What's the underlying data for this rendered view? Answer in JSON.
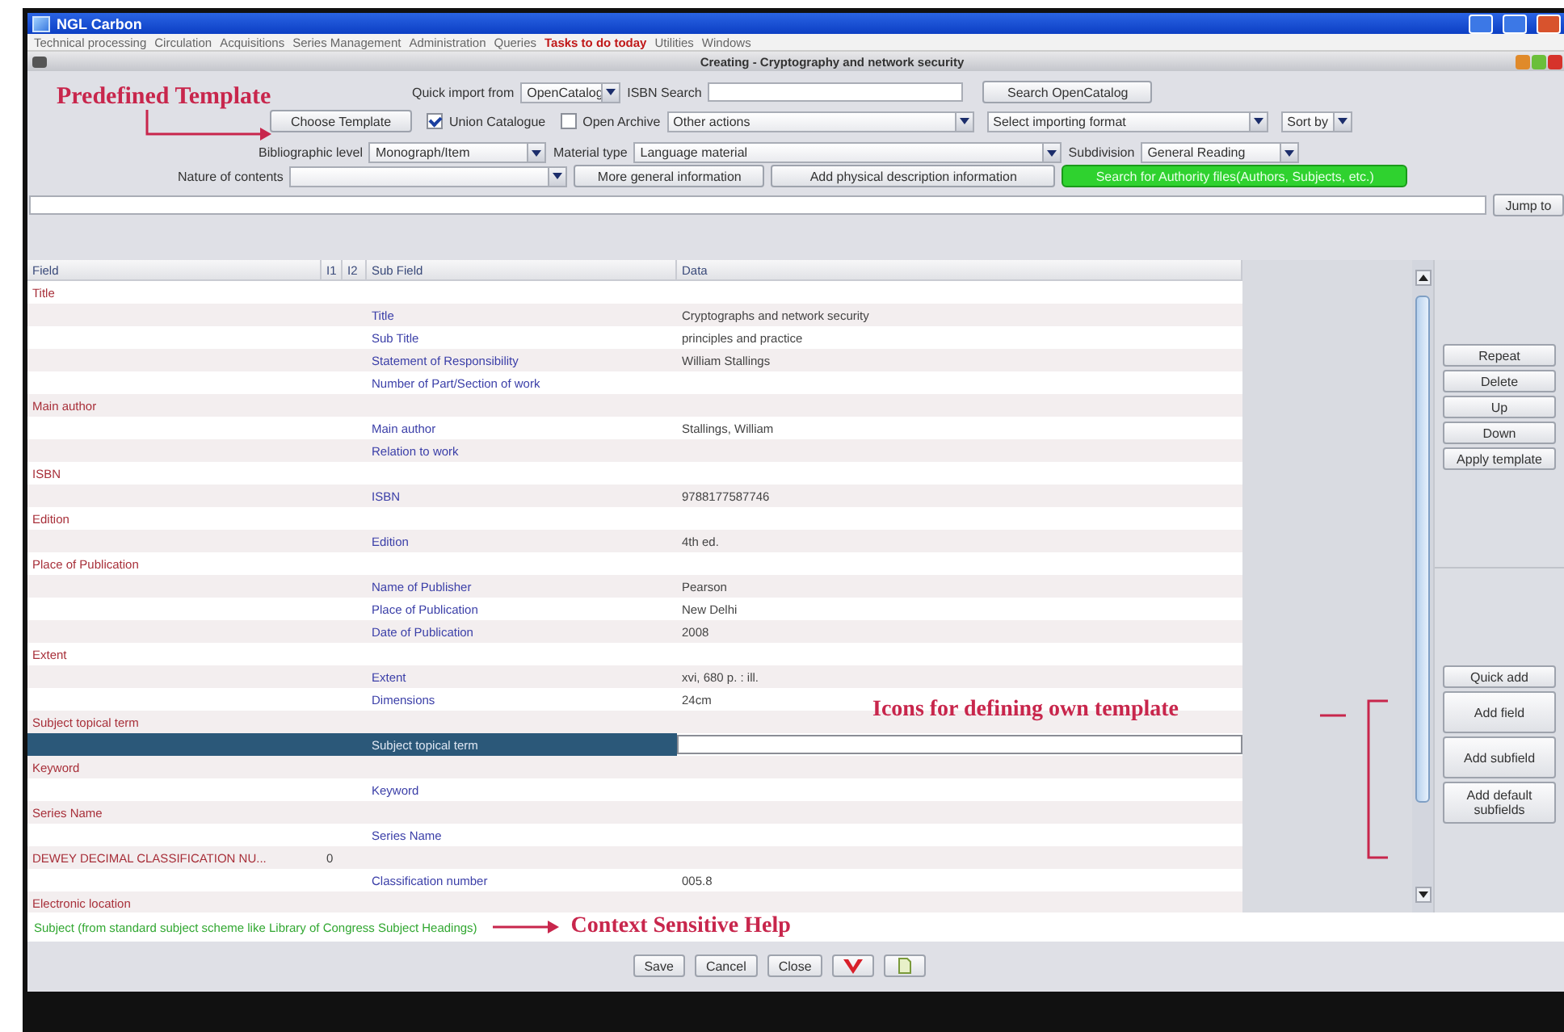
{
  "window": {
    "title": "NGL Carbon"
  },
  "menu": [
    {
      "label": "Technical processing",
      "highlighted": false
    },
    {
      "label": "Circulation",
      "highlighted": false
    },
    {
      "label": "Acquisitions",
      "highlighted": false
    },
    {
      "label": "Series Management",
      "highlighted": false
    },
    {
      "label": "Administration",
      "highlighted": false
    },
    {
      "label": "Queries",
      "highlighted": false
    },
    {
      "label": "Tasks to do today",
      "highlighted": true
    },
    {
      "label": "Utilities",
      "highlighted": false
    },
    {
      "label": "Windows",
      "highlighted": false
    }
  ],
  "frame": {
    "title": "Creating - Cryptography and network security"
  },
  "toolbar": {
    "quick_import_label": "Quick import from",
    "quick_import_value": "OpenCatalog",
    "isbn_label": "ISBN Search",
    "search_button": "Search OpenCatalog",
    "choose_template": "Choose Template",
    "checkboxes": [
      {
        "label": "Union Catalogue",
        "checked": true
      },
      {
        "label": "Open Archive",
        "checked": false
      }
    ],
    "other_actions": "Other actions",
    "import_format": "Select importing format",
    "sort_by": "Sort by",
    "bibliographic_level_label": "Bibliographic level",
    "bibliographic_level": "Monograph/Item",
    "material_type_label": "Material type",
    "material_type": "Language material",
    "subdivision_label": "Subdivision",
    "subdivision": "General Reading",
    "nature_label": "Nature of contents",
    "more_info_button": "More general information",
    "physical_button": "Add physical description information",
    "authority_button": "Search for Authority files(Authors, Subjects, etc.)",
    "jump_button": "Jump to"
  },
  "table": {
    "columns": [
      "Field",
      "I1",
      "I2",
      "Sub Field",
      "Data"
    ],
    "rows": [
      {
        "kind": "field",
        "text": "Title",
        "selected": false
      },
      {
        "kind": "subfield",
        "text": "Title",
        "data": "Cryptographs and network security",
        "selected": false
      },
      {
        "kind": "subfield",
        "text": "Sub Title",
        "data": "principles and practice",
        "selected": false
      },
      {
        "kind": "subfield",
        "text": "Statement of Responsibility",
        "data": "William Stallings",
        "selected": false
      },
      {
        "kind": "subfield",
        "text": "Number of Part/Section of work",
        "selected": false
      },
      {
        "kind": "field",
        "text": "Main author",
        "selected": false
      },
      {
        "kind": "subfield",
        "text": "Main author",
        "data": "Stallings, William",
        "selected": false
      },
      {
        "kind": "subfield",
        "text": "Relation to work",
        "selected": false
      },
      {
        "kind": "field",
        "text": "ISBN",
        "selected": false
      },
      {
        "kind": "subfield",
        "text": "ISBN",
        "data": "9788177587746",
        "selected": false
      },
      {
        "kind": "field",
        "text": "Edition",
        "selected": false
      },
      {
        "kind": "subfield",
        "text": "Edition",
        "data": "4th ed.",
        "selected": false
      },
      {
        "kind": "field",
        "text": "Place of Publication",
        "selected": false
      },
      {
        "kind": "subfield",
        "text": "Name of Publisher",
        "data": "Pearson",
        "selected": false
      },
      {
        "kind": "subfield",
        "text": "Place of Publication",
        "data": "New Delhi",
        "selected": false
      },
      {
        "kind": "subfield",
        "text": "Date of Publication",
        "data": "2008",
        "selected": false
      },
      {
        "kind": "field",
        "text": "Extent",
        "selected": false
      },
      {
        "kind": "subfield",
        "text": "Extent",
        "data": "xvi, 680 p. : ill.",
        "selected": false
      },
      {
        "kind": "subfield",
        "text": "Dimensions",
        "data": "24cm",
        "selected": false
      },
      {
        "kind": "field",
        "text": "Subject topical term",
        "selected": false
      },
      {
        "kind": "subfield",
        "text": "Subject topical term",
        "selected": true
      },
      {
        "kind": "field",
        "text": "Keyword",
        "selected": false
      },
      {
        "kind": "subfield",
        "text": "Keyword",
        "selected": false
      },
      {
        "kind": "field",
        "text": "Series Name",
        "selected": false
      },
      {
        "kind": "subfield",
        "text": "Series Name",
        "selected": false
      },
      {
        "kind": "field",
        "text": "DEWEY DECIMAL CLASSIFICATION NU...",
        "i1": "0",
        "selected": false
      },
      {
        "kind": "subfield",
        "text": "Classification number",
        "data": "005.8",
        "selected": false
      },
      {
        "kind": "field",
        "text": "Electronic location",
        "selected": false
      }
    ]
  },
  "side_buttons": [
    "Repeat",
    "Delete",
    "Up",
    "Down",
    "Apply template"
  ],
  "template_buttons": [
    "Quick add",
    "Add field",
    "Add subfield",
    "Add default subfields"
  ],
  "help": "Subject (from standard subject scheme like Library of Congress Subject Headings)",
  "footer_buttons": [
    "Save",
    "Cancel",
    "Close"
  ],
  "annotations": [
    {
      "kind": "template",
      "text": "Predefined Template"
    },
    {
      "kind": "bracket",
      "text": "Icons for defining own template"
    },
    {
      "kind": "help",
      "text": "Context Sensitive Help"
    }
  ]
}
